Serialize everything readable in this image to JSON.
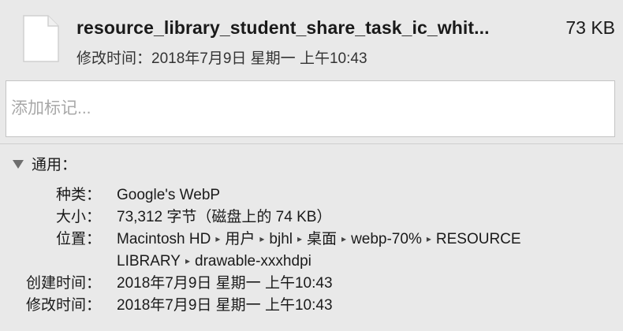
{
  "file": {
    "name": "resource_library_student_share_task_ic_whit...",
    "size": "73 KB",
    "modified_line": "修改时间：2018年7月9日 星期一 上午10:43"
  },
  "tags": {
    "placeholder": "添加标记..."
  },
  "general": {
    "title": "通用：",
    "kind_label": "种类：",
    "kind_value": "Google's WebP",
    "size_label": "大小：",
    "size_value": "73,312 字节（磁盘上的 74 KB）",
    "where_label": "位置：",
    "where_path": [
      "Macintosh HD",
      "用户",
      "bjhl",
      "桌面",
      "webp-70%",
      "RESOURCE"
    ],
    "where_path_line2": [
      "LIBRARY",
      "drawable-xxxhdpi"
    ],
    "created_label": "创建时间：",
    "created_value": "2018年7月9日 星期一 上午10:43",
    "modified_label": "修改时间：",
    "modified_value": "2018年7月9日 星期一 上午10:43"
  }
}
